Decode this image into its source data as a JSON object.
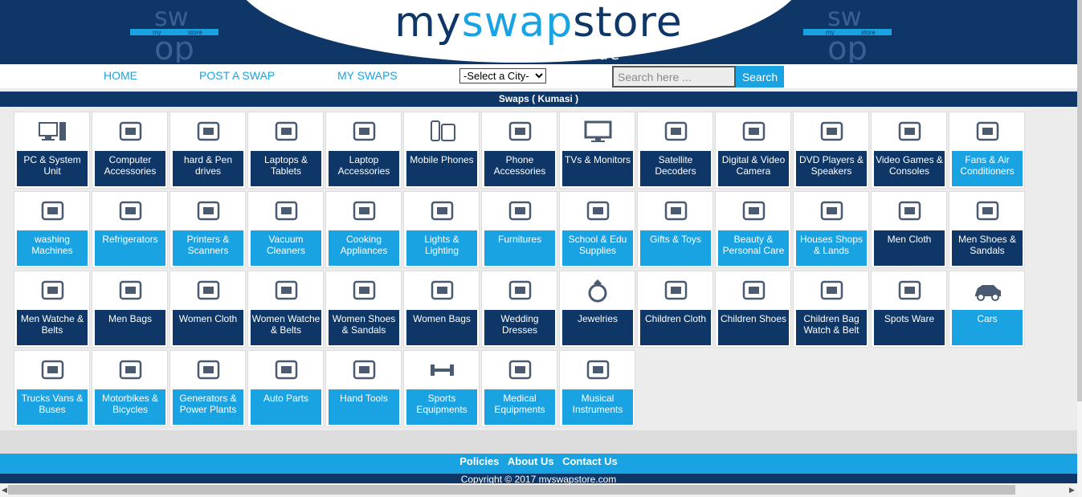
{
  "header": {
    "brand_part1": "my",
    "brand_part2": "swap",
    "brand_part3": "store",
    "tagline": "its a batter trade",
    "logo_icon": "swap-logo-icon",
    "colors": {
      "navy": "#0e3768",
      "sky": "#1aa3e3"
    }
  },
  "nav": {
    "home": "HOME",
    "post": "POST A SWAP",
    "myswaps": "MY SWAPS",
    "city_select": "-Select a City-",
    "search_placeholder": "Search here ...",
    "search_button": "Search"
  },
  "section_title": "Swaps ( Kumasi )",
  "categories": [
    {
      "label": "PC & System Unit",
      "icon": "desktop-pc-icon",
      "style": "navy"
    },
    {
      "label": "Computer Accessories",
      "icon": "computer-accessories-icon",
      "style": "navy"
    },
    {
      "label": "hard & Pen drives",
      "icon": "usb-drive-icon",
      "style": "navy"
    },
    {
      "label": "Laptops & Tablets",
      "icon": "laptop-tablet-icon",
      "style": "navy"
    },
    {
      "label": "Laptop Accessories",
      "icon": "laptop-accessories-icon",
      "style": "navy"
    },
    {
      "label": "Mobile Phones",
      "icon": "mobile-phone-icon",
      "style": "navy"
    },
    {
      "label": "Phone Accessories",
      "icon": "phone-accessories-icon",
      "style": "navy"
    },
    {
      "label": "TVs & Monitors",
      "icon": "tv-monitor-icon",
      "style": "navy"
    },
    {
      "label": "Satellite Decoders",
      "icon": "satellite-decoder-icon",
      "style": "navy"
    },
    {
      "label": "Digital & Video Camera",
      "icon": "video-camera-icon",
      "style": "navy"
    },
    {
      "label": "DVD Players & Speakers",
      "icon": "speaker-icon",
      "style": "navy"
    },
    {
      "label": "Video Games & Consoles",
      "icon": "game-controller-icon",
      "style": "navy"
    },
    {
      "label": "Fans & Air Conditioners",
      "icon": "air-conditioner-icon",
      "style": "sky"
    },
    {
      "label": "washing Machines",
      "icon": "washing-machine-icon",
      "style": "sky"
    },
    {
      "label": "Refrigerators",
      "icon": "refrigerator-icon",
      "style": "sky"
    },
    {
      "label": "Printers & Scanners",
      "icon": "printer-icon",
      "style": "sky"
    },
    {
      "label": "Vacuum Cleaners",
      "icon": "vacuum-cleaner-icon",
      "style": "sky"
    },
    {
      "label": "Cooking Appliances",
      "icon": "cooking-appliances-icon",
      "style": "sky"
    },
    {
      "label": "Lights & Lighting",
      "icon": "ceiling-light-icon",
      "style": "sky"
    },
    {
      "label": "Furnitures",
      "icon": "sofa-icon",
      "style": "sky"
    },
    {
      "label": "School & Edu Supplies",
      "icon": "school-desk-icon",
      "style": "sky"
    },
    {
      "label": "Gifts & Toys",
      "icon": "toys-icon",
      "style": "sky"
    },
    {
      "label": "Beauty & Personal Care",
      "icon": "cosmetics-icon",
      "style": "sky"
    },
    {
      "label": "Houses Shops & Lands",
      "icon": "house-icon",
      "style": "sky"
    },
    {
      "label": "Men Cloth",
      "icon": "men-suit-icon",
      "style": "navy"
    },
    {
      "label": "Men Shoes & Sandals",
      "icon": "men-shoes-icon",
      "style": "navy"
    },
    {
      "label": "Men Watche & Belts",
      "icon": "watch-belt-icon",
      "style": "navy"
    },
    {
      "label": "Men Bags",
      "icon": "men-bags-icon",
      "style": "navy"
    },
    {
      "label": "Women Cloth",
      "icon": "women-dress-icon",
      "style": "navy"
    },
    {
      "label": "Women Watche & Belts",
      "icon": "women-watch-icon",
      "style": "navy"
    },
    {
      "label": "Women Shoes & Sandals",
      "icon": "high-heels-icon",
      "style": "navy"
    },
    {
      "label": "Women Bags",
      "icon": "handbag-icon",
      "style": "navy"
    },
    {
      "label": "Wedding Dresses",
      "icon": "wedding-dress-icon",
      "style": "navy"
    },
    {
      "label": "Jewelries",
      "icon": "ring-icon",
      "style": "navy"
    },
    {
      "label": "Children Cloth",
      "icon": "children-cloth-icon",
      "style": "navy"
    },
    {
      "label": "Children Shoes",
      "icon": "children-shoes-icon",
      "style": "navy"
    },
    {
      "label": "Children Bag Watch & Belt",
      "icon": "school-bag-icon",
      "style": "navy"
    },
    {
      "label": "Spots Ware",
      "icon": "sport-shoe-icon",
      "style": "navy"
    },
    {
      "label": "Cars",
      "icon": "car-icon",
      "style": "sky"
    },
    {
      "label": "Trucks Vans & Buses",
      "icon": "truck-bus-icon",
      "style": "sky"
    },
    {
      "label": "Motorbikes & Bicycles",
      "icon": "motorbike-icon",
      "style": "sky"
    },
    {
      "label": "Generators & Power Plants",
      "icon": "generator-icon",
      "style": "sky"
    },
    {
      "label": "Auto Parts",
      "icon": "auto-parts-icon",
      "style": "sky"
    },
    {
      "label": "Hand Tools",
      "icon": "hand-tools-icon",
      "style": "sky"
    },
    {
      "label": "Sports Equipments",
      "icon": "dumbbell-icon",
      "style": "sky"
    },
    {
      "label": "Medical Equipments",
      "icon": "microscope-icon",
      "style": "sky"
    },
    {
      "label": "Musical Instruments",
      "icon": "musical-instruments-icon",
      "style": "sky"
    }
  ],
  "footer": {
    "policies": "Policies",
    "about": "About Us",
    "contact": "Contact Us",
    "copyright": "Copyright © 2017 myswapstore.com"
  }
}
